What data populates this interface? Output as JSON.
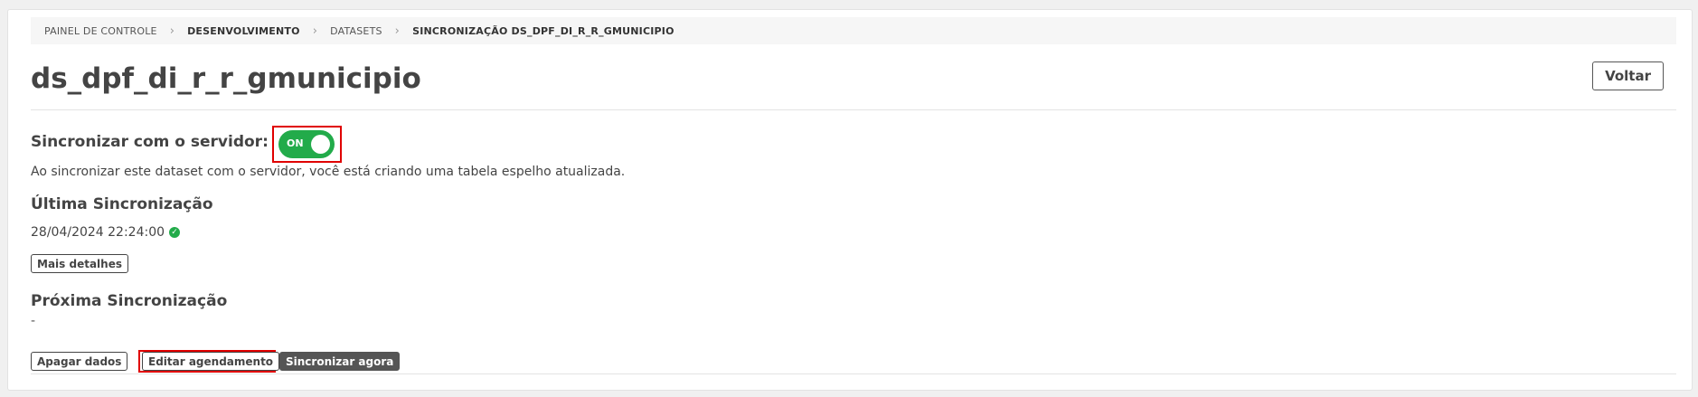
{
  "breadcrumb": {
    "items": [
      {
        "label": "PAINEL DE CONTROLE"
      },
      {
        "label": "DESENVOLVIMENTO"
      },
      {
        "label": "DATASETS"
      },
      {
        "label": "SINCRONIZAÇÃO DS_DPF_DI_R_R_GMUNICIPIO"
      }
    ],
    "separator": "›"
  },
  "header": {
    "title": "ds_dpf_di_r_r_gmunicipio",
    "back_label": "Voltar"
  },
  "sync": {
    "label": "Sincronizar com o servidor:",
    "toggle_state": "ON",
    "description": "Ao sincronizar este dataset com o servidor, você está criando uma tabela espelho atualizada."
  },
  "last_sync": {
    "title": "Última Sincronização",
    "datetime": "28/04/2024 22:24:00",
    "status_icon": "check-circle-icon",
    "details_label": "Mais detalhes"
  },
  "next_sync": {
    "title": "Próxima Sincronização",
    "value": "-"
  },
  "actions": {
    "delete_label": "Apagar dados",
    "edit_schedule_label": "Editar agendamento",
    "sync_now_label": "Sincronizar agora"
  },
  "colors": {
    "toggle_on": "#22ab4a",
    "highlight": "#e00000",
    "dark_button": "#555555"
  }
}
